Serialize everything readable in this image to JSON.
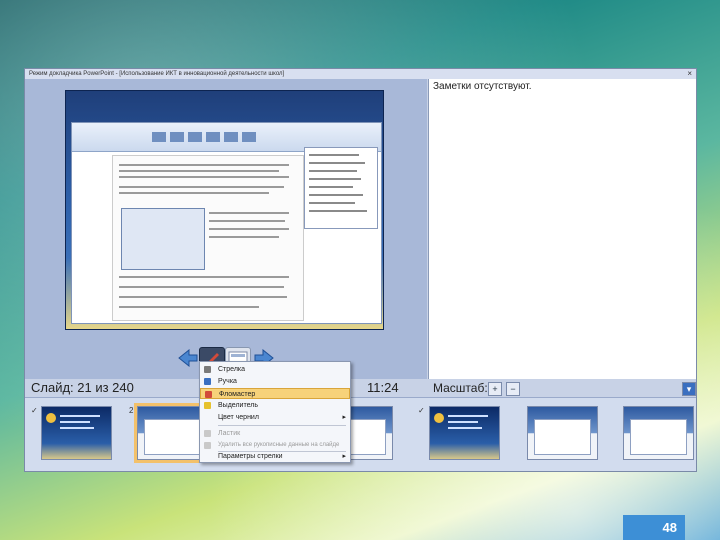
{
  "window": {
    "title": "Режим докладчика PowerPoint - [Использование ИКТ в инновационной деятельности школ]",
    "close_glyph": "×"
  },
  "presenter": {
    "slide_counter": "Слайд: 21 из 240",
    "clock": "11:24",
    "notes_text": "Заметки отсутствуют.",
    "zoom_label": "Масштаб:",
    "zoom_in": "+",
    "zoom_out": "−",
    "collapse": "▾"
  },
  "nav": {
    "prev_glyph": "◀",
    "next_glyph": "▶"
  },
  "context_menu": {
    "items": [
      {
        "label": "Стрелка",
        "icon": "arrow-icon",
        "state": "normal",
        "submenu": false
      },
      {
        "label": "Ручка",
        "icon": "pen-icon",
        "state": "normal",
        "submenu": false
      },
      {
        "label": "Фломастер",
        "icon": "felt-pen-icon",
        "state": "highlighted",
        "submenu": false
      },
      {
        "label": "Выделитель",
        "icon": "highlighter-icon",
        "state": "normal",
        "submenu": false
      },
      {
        "label": "Цвет чернил",
        "icon": "",
        "state": "normal",
        "submenu": true
      },
      {
        "label": "Ластик",
        "icon": "eraser-icon",
        "state": "disabled",
        "submenu": false
      },
      {
        "label": "Удалить все рукописные данные на слайде",
        "icon": "clear-ink-icon",
        "state": "disabled",
        "submenu": false
      },
      {
        "label": "Параметры стрелки",
        "icon": "",
        "state": "normal",
        "submenu": true
      }
    ]
  },
  "thumbnails": [
    {
      "mark": "✓",
      "style": "dark"
    },
    {
      "mark": "21",
      "style": "shot",
      "selected": true
    },
    {
      "mark": "",
      "style": "shot"
    },
    {
      "mark": "",
      "style": "shot"
    },
    {
      "mark": "",
      "style": "shot"
    },
    {
      "mark": "✓",
      "style": "dark"
    },
    {
      "mark": "",
      "style": "shot"
    },
    {
      "mark": "",
      "style": "shot"
    }
  ],
  "page_number": "48",
  "colors": {
    "accent": "#3d8fd6",
    "highlight": "#f7d27a",
    "window_bg": "#c8d2e6"
  }
}
